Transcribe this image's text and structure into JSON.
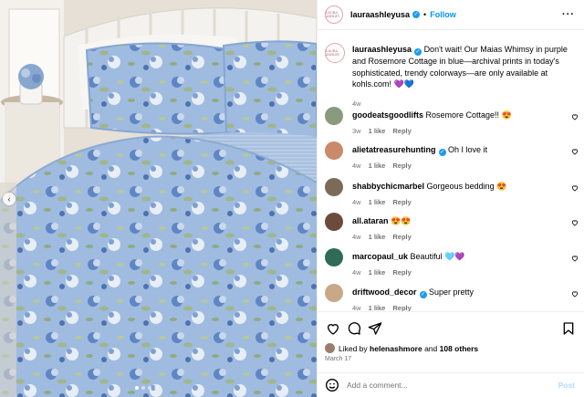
{
  "post_image": {
    "alt": "",
    "carousel_dots": 4,
    "active_dot": 0
  },
  "account": {
    "username": "lauraashleyusa",
    "avatar_text": "LAURA ASHLEY",
    "follow_label": "Follow",
    "separator": "•",
    "more_label": "···"
  },
  "caption": {
    "username": "lauraashleyusa",
    "text": "Don't wait! Our Maias Whimsy in purple and Rosemore Cottage in blue—archival prints in today's sophisticated, trendy colorways—are only available at kohls.com! 💜💙",
    "time": "4w"
  },
  "comments": [
    {
      "username": "goodeatsgoodlifts",
      "verified": false,
      "text": "Rosemore Cottage!! 😍",
      "time": "3w",
      "likes": "1 like",
      "reply": "Reply",
      "avatar_color": "#8a9a7c"
    },
    {
      "username": "alietatreasurehunting",
      "verified": true,
      "text": "Oh I love it",
      "time": "4w",
      "likes": "1 like",
      "reply": "Reply",
      "avatar_color": "#c98a6a"
    },
    {
      "username": "shabbychicmarbel",
      "verified": false,
      "text": "Gorgeous bedding 😍",
      "time": "4w",
      "likes": "1 like",
      "reply": "Reply",
      "avatar_color": "#7b6a58"
    },
    {
      "username": "all.ataran",
      "verified": false,
      "text": "😍😍",
      "time": "4w",
      "likes": "1 like",
      "reply": "Reply",
      "avatar_color": "#6c4a3c"
    },
    {
      "username": "marcopaul_uk",
      "verified": false,
      "text": "Beautiful 🩵💜",
      "time": "4w",
      "likes": "1 like",
      "reply": "Reply",
      "avatar_color": "#2f6b57"
    },
    {
      "username": "driftwood_decor",
      "verified": true,
      "text": "Super pretty",
      "time": "4w",
      "likes": "1 like",
      "reply": "Reply",
      "avatar_color": "#c9a88a"
    }
  ],
  "likes": {
    "prefix": "Liked by",
    "user": "helenashmore",
    "conj": "and",
    "others": "108 others"
  },
  "date": "March 17",
  "add_comment": {
    "placeholder": "Add a comment...",
    "post_label": "Post"
  },
  "colors": {
    "accent_blue": "#0095f6",
    "verified_blue": "#1d9bf0",
    "muted_text": "#737373",
    "post_disabled": "#b3dbff"
  },
  "icons": {
    "nav_prev": "chevron-left-icon",
    "like": "heart-icon",
    "comment": "comment-bubble-icon",
    "share": "paper-plane-icon",
    "save": "bookmark-icon",
    "emoji": "smiley-icon"
  }
}
